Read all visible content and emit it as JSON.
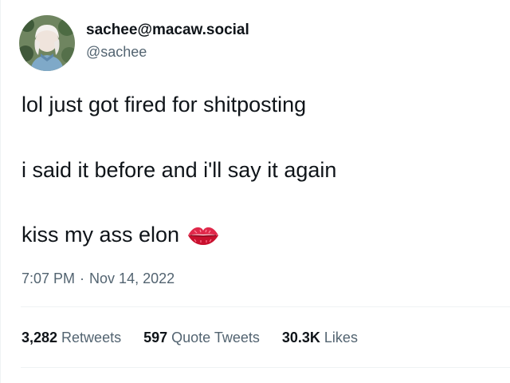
{
  "author": {
    "display_name": "sachee@macaw.social",
    "handle": "@sachee",
    "avatar_icon": "profile-photo"
  },
  "tweet": {
    "lines": [
      "lol just got fired for shitposting",
      "i said it before and i'll say it again",
      "kiss my ass elon"
    ],
    "emoji": "kiss-mark-icon",
    "time": "7:07 PM",
    "separator": "·",
    "date": "Nov 14, 2022"
  },
  "stats": {
    "retweets": {
      "count": "3,282",
      "label": "Retweets"
    },
    "quote_tweets": {
      "count": "597",
      "label": "Quote Tweets"
    },
    "likes": {
      "count": "30.3K",
      "label": "Likes"
    }
  },
  "colors": {
    "text_primary": "#0f1419",
    "text_secondary": "#536471",
    "divider": "#eff3f4",
    "kiss_red": "#e0284a"
  }
}
